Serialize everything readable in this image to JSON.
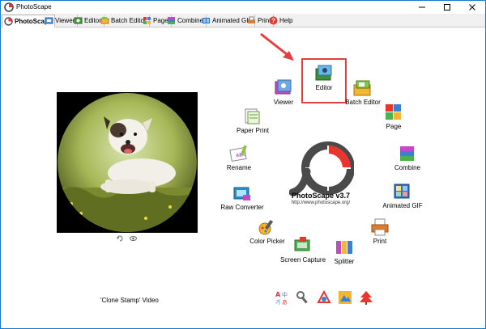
{
  "window": {
    "title": "PhotoScape"
  },
  "tabs": [
    {
      "label": "PhotoScape",
      "icon": "photoscape-tab-icon",
      "active": true
    },
    {
      "label": "Viewer",
      "icon": "viewer-tab-icon"
    },
    {
      "label": "Editor",
      "icon": "editor-tab-icon"
    },
    {
      "label": "Batch Editor",
      "icon": "batch-editor-tab-icon"
    },
    {
      "label": "Page",
      "icon": "page-tab-icon"
    },
    {
      "label": "Combine",
      "icon": "combine-tab-icon"
    },
    {
      "label": "Animated GIF",
      "icon": "animated-gif-tab-icon"
    },
    {
      "label": "Print",
      "icon": "print-tab-icon"
    },
    {
      "label": "Help",
      "icon": "help-tab-icon"
    }
  ],
  "menu": {
    "editor": "Editor",
    "viewer": "Viewer",
    "batch_editor": "Batch Editor",
    "paper_print": "Paper Print",
    "page": "Page",
    "rename": "Rename",
    "combine": "Combine",
    "raw_converter": "Raw Converter",
    "animated_gif": "Animated GIF",
    "color_picker": "Color Picker",
    "print": "Print",
    "screen_capture": "Screen Capture",
    "splitter": "Splitter"
  },
  "center": {
    "title": "PhotoScape v3.7",
    "url": "http://www.photoscape.org/"
  },
  "preview": {
    "caption": "'Clone Stamp' Video"
  },
  "colors": {
    "accent": "#1979ca",
    "highlight": "#e0403f",
    "logo_red": "#e8352e"
  }
}
